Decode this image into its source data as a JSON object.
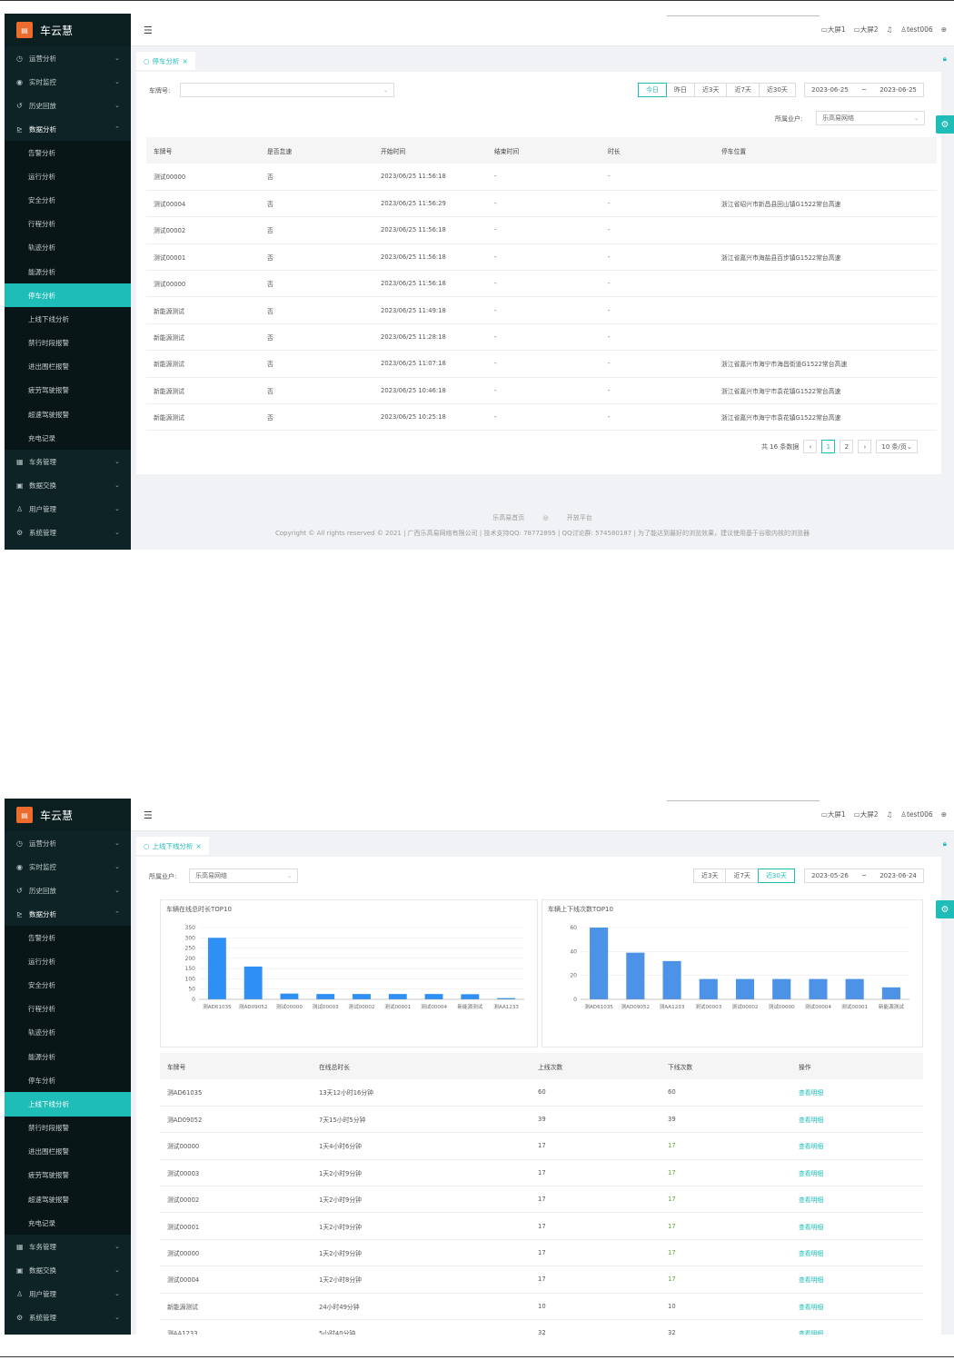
{
  "app": {
    "logo_icon": "▤",
    "name": "车云慧"
  },
  "header": {
    "screen1": "大屏1",
    "screen2": "大屏2",
    "user": "test006"
  },
  "menu": {
    "top": [
      "运营分析",
      "实时监控",
      "历史回放"
    ],
    "data_analysis": "数据分析",
    "sub": [
      "告警分析",
      "运行分析",
      "安全分析",
      "行程分析",
      "轨迹分析",
      "能源分析",
      "停车分析",
      "上线下线分析",
      "禁行时段报警",
      "进出围栏报警",
      "疲劳驾驶报警",
      "超速驾驶报警",
      "充电记录"
    ],
    "bottom": [
      "车务管理",
      "数据交换",
      "用户管理",
      "系统管理"
    ]
  },
  "s1": {
    "tab": "停车分析",
    "plate_label": "车牌号:",
    "owner_label": "所属业户:",
    "owner_value": "乐高易网络",
    "quick": [
      "今日",
      "昨日",
      "近3天",
      "近7天",
      "近30天"
    ],
    "quick_active": 0,
    "date_start": "2023-06-25",
    "date_sep": "~",
    "date_end": "2023-06-25",
    "columns": [
      "车牌号",
      "是否怠速",
      "开始时间",
      "结束时间",
      "时长",
      "停车位置"
    ],
    "rows": [
      [
        "测试00000",
        "否",
        "2023/06/25 11:56:18",
        "-",
        "-",
        ""
      ],
      [
        "测试00004",
        "否",
        "2023/06/25 11:56:29",
        "-",
        "-",
        "浙江省绍兴市新昌县回山镇G1522常台高速"
      ],
      [
        "测试00002",
        "否",
        "2023/06/25 11:56:18",
        "-",
        "-",
        ""
      ],
      [
        "测试00001",
        "否",
        "2023/06/25 11:56:18",
        "-",
        "-",
        "浙江省嘉兴市海盐县百步镇G1522常台高速"
      ],
      [
        "测试00000",
        "否",
        "2023/06/25 11:56:18",
        "-",
        "-",
        ""
      ],
      [
        "新能源测试",
        "否",
        "2023/06/25 11:49:18",
        "-",
        "-",
        ""
      ],
      [
        "新能源测试",
        "否",
        "2023/06/25 11:28:18",
        "-",
        "-",
        ""
      ],
      [
        "新能源测试",
        "否",
        "2023/06/25 11:07:18",
        "-",
        "-",
        "浙江省嘉兴市海宁市海昌街道G1522常台高速"
      ],
      [
        "新能源测试",
        "否",
        "2023/06/25 10:46:18",
        "-",
        "-",
        "浙江省嘉兴市海宁市袁花镇G1522常台高速"
      ],
      [
        "新能源测试",
        "否",
        "2023/06/25 10:25:18",
        "-",
        "-",
        "浙江省嘉兴市海宁市袁花镇G1522常台高速"
      ]
    ],
    "total": "共 16 条数据",
    "pages": [
      "1",
      "2"
    ],
    "page_size": "10 条/页",
    "footer_links": [
      "乐高易首页",
      "开放平台"
    ],
    "footer_copy": "Copyright © All rights reserved © 2021 | 广西乐高易网络有限公司 | 技术支持QQ: 78772895 | QQ讨论群: 574580187 | 为了能达到最好的浏览效果，建议使用基于谷歌内核的浏览器"
  },
  "s2": {
    "tab": "上线下线分析",
    "owner_label": "所属业户:",
    "owner_value": "乐高易网络",
    "quick": [
      "近3天",
      "近7天",
      "近30天"
    ],
    "quick_active": 2,
    "date_start": "2023-05-26",
    "date_sep": "~",
    "date_end": "2023-06-24",
    "columns": [
      "车牌号",
      "在线总时长",
      "上线次数",
      "下线次数",
      "操作"
    ],
    "rows": [
      [
        "测AD61035",
        "13天12小时16分钟",
        "60",
        "60",
        "查看明细"
      ],
      [
        "测AD09052",
        "7天15小时5分钟",
        "39",
        "39",
        "查看明细"
      ],
      [
        "测试00000",
        "1天4小时6分钟",
        "17",
        "17",
        "查看明细"
      ],
      [
        "测试00003",
        "1天2小时9分钟",
        "17",
        "17",
        "查看明细"
      ],
      [
        "测试00002",
        "1天2小时9分钟",
        "17",
        "17",
        "查看明细"
      ],
      [
        "测试00001",
        "1天2小时9分钟",
        "17",
        "17",
        "查看明细"
      ],
      [
        "测试00000",
        "1天2小时9分钟",
        "17",
        "17",
        "查看明细"
      ],
      [
        "测试00004",
        "1天2小时8分钟",
        "17",
        "17",
        "查看明细"
      ],
      [
        "新能源测试",
        "24小时49分钟",
        "10",
        "10",
        "查看明细"
      ],
      [
        "测AA1233",
        "5小时40分钟",
        "32",
        "32",
        "查看明细"
      ]
    ]
  },
  "chart_data": [
    {
      "type": "bar",
      "title": "车辆在线总时长TOP10",
      "categories": [
        "测AD61035",
        "测AD09052",
        "测试00000",
        "测试00003",
        "测试00002",
        "测试00001",
        "测试00004",
        "新能源测试",
        "测AA1233"
      ],
      "values": [
        300,
        160,
        28,
        26,
        26,
        26,
        26,
        25,
        6
      ],
      "ylim": [
        0,
        350
      ],
      "yticks": [
        0,
        50,
        100,
        150,
        200,
        250,
        300,
        350
      ],
      "color": "#2e8ff5"
    },
    {
      "type": "bar",
      "title": "车辆上下线次数TOP10",
      "categories": [
        "测AD61035",
        "测AD09052",
        "测AA1233",
        "测试00003",
        "测试00002",
        "测试00000",
        "测试00004",
        "测试00001",
        "新能源测试"
      ],
      "values": [
        60,
        39,
        32,
        17,
        17,
        17,
        17,
        17,
        10
      ],
      "ylim": [
        0,
        60
      ],
      "yticks": [
        0,
        20,
        40,
        60
      ],
      "color": "#4c92e6"
    }
  ]
}
